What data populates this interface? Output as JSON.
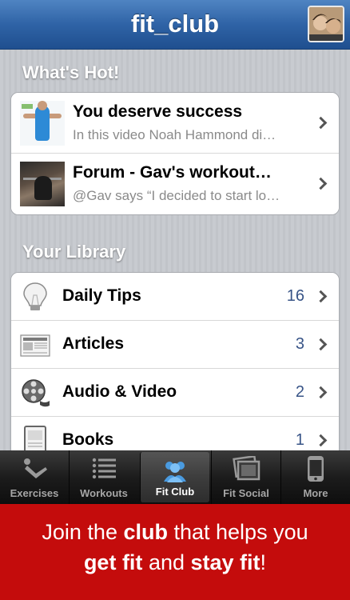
{
  "nav": {
    "title": "fit_club",
    "avatar_icon": "profile-photo"
  },
  "whats_hot": {
    "header": "What's Hot!",
    "items": [
      {
        "title": "You deserve success",
        "subtitle": "In this video Noah Hammond di…",
        "thumb_icon": "video-thumbnail"
      },
      {
        "title": "Forum - Gav's workout…",
        "subtitle": "@Gav says “I decided to start lo…",
        "thumb_icon": "forum-thumbnail"
      }
    ]
  },
  "library": {
    "header": "Your Library",
    "items": [
      {
        "label": "Daily Tips",
        "count": "16",
        "icon": "lightbulb-icon"
      },
      {
        "label": "Articles",
        "count": "3",
        "icon": "newspaper-icon"
      },
      {
        "label": "Audio & Video",
        "count": "2",
        "icon": "film-reel-icon"
      },
      {
        "label": "Books",
        "count": "1",
        "icon": "book-icon"
      }
    ]
  },
  "tabs": [
    {
      "label": "Exercises",
      "icon": "exercise-icon",
      "active": false
    },
    {
      "label": "Workouts",
      "icon": "list-icon",
      "active": false
    },
    {
      "label": "Fit Club",
      "icon": "people-icon",
      "active": true
    },
    {
      "label": "Fit Social",
      "icon": "photos-icon",
      "active": false
    },
    {
      "label": "More",
      "icon": "phone-icon",
      "active": false
    }
  ],
  "promo": {
    "line1_a": "Join the ",
    "line1_b": "club",
    "line1_c": " that helps you",
    "line2_a": "get fit",
    "line2_b": " and ",
    "line2_c": "stay fit",
    "line2_d": "!"
  },
  "colors": {
    "nav_blue": "#2f63a6",
    "promo_red": "#c40c0c",
    "count_blue": "#385487"
  }
}
